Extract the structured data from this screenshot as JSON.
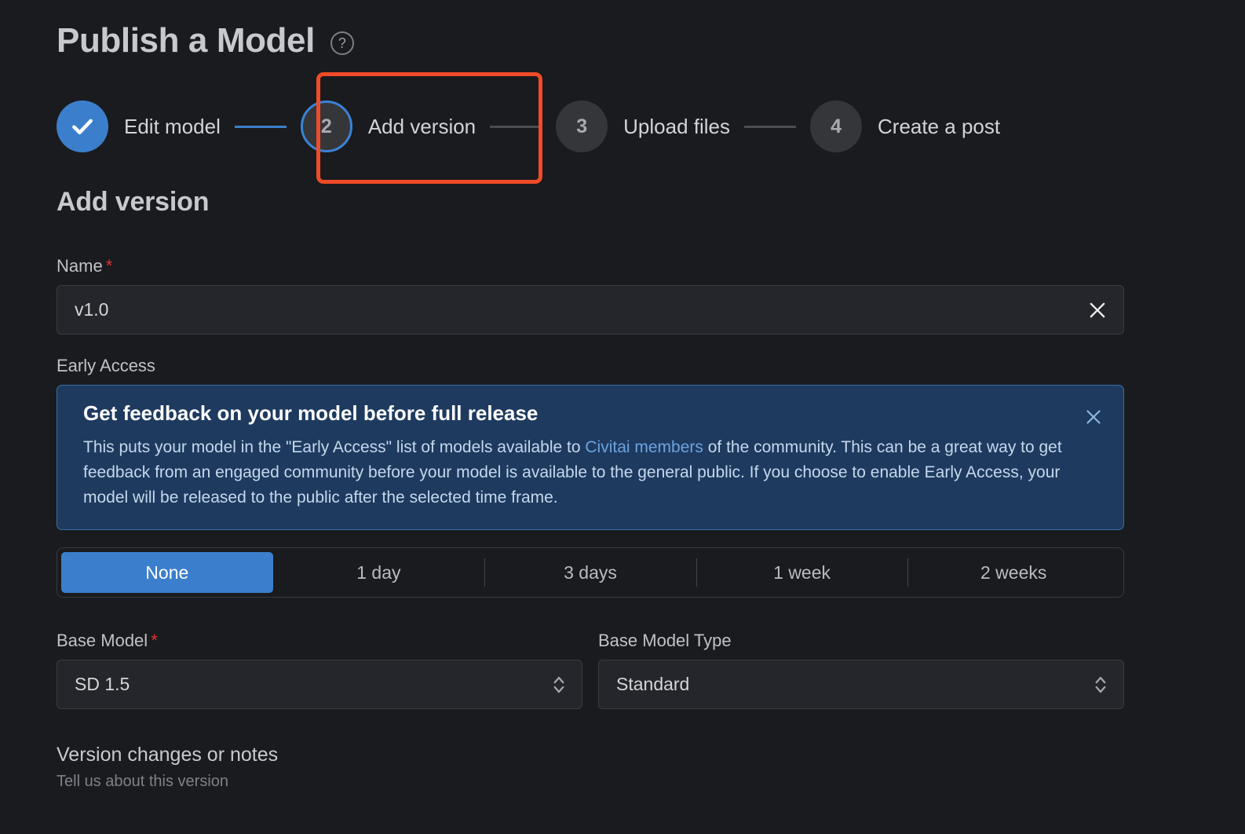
{
  "header": {
    "title": "Publish a Model",
    "help_icon": "help-circle-icon",
    "help_glyph": "?"
  },
  "stepper": {
    "steps": [
      {
        "number": "1",
        "label": "Edit model",
        "state": "done",
        "marker": "check-icon"
      },
      {
        "number": "2",
        "label": "Add version",
        "state": "active",
        "marker": "2"
      },
      {
        "number": "3",
        "label": "Upload files",
        "state": "todo",
        "marker": "3"
      },
      {
        "number": "4",
        "label": "Create a post",
        "state": "todo",
        "marker": "4"
      }
    ],
    "highlight_color": "#f04b28",
    "active_color": "#3b82d6"
  },
  "section": {
    "heading": "Add version"
  },
  "name_field": {
    "label": "Name",
    "required_marker": "*",
    "value": "v1.0",
    "placeholder": "",
    "clear_icon": "close-icon"
  },
  "early_access": {
    "label": "Early Access",
    "alert": {
      "title": "Get feedback on your model before full release",
      "body_part1": "This puts your model in the \"Early Access\" list of models available to ",
      "link_text": "Civitai members",
      "body_part2": " of the community. This can be a great way to get feedback from an engaged community before your model is available to the general public. If you choose to enable Early Access, your model will be released to the public after the selected time frame.",
      "close_icon": "close-icon",
      "bg_color": "#1e3a5f",
      "border_color": "#3b6ea5"
    },
    "options": [
      {
        "label": "None",
        "selected": true
      },
      {
        "label": "1 day",
        "selected": false
      },
      {
        "label": "3 days",
        "selected": false
      },
      {
        "label": "1 week",
        "selected": false
      },
      {
        "label": "2 weeks",
        "selected": false
      }
    ],
    "selected_color": "#3b7fcc"
  },
  "base_model": {
    "label": "Base Model",
    "required_marker": "*",
    "value": "SD 1.5",
    "chevron_icon": "chevron-up-down-icon"
  },
  "base_model_type": {
    "label": "Base Model Type",
    "value": "Standard",
    "chevron_icon": "chevron-up-down-icon"
  },
  "version_notes": {
    "title": "Version changes or notes",
    "subtitle": "Tell us about this version"
  }
}
